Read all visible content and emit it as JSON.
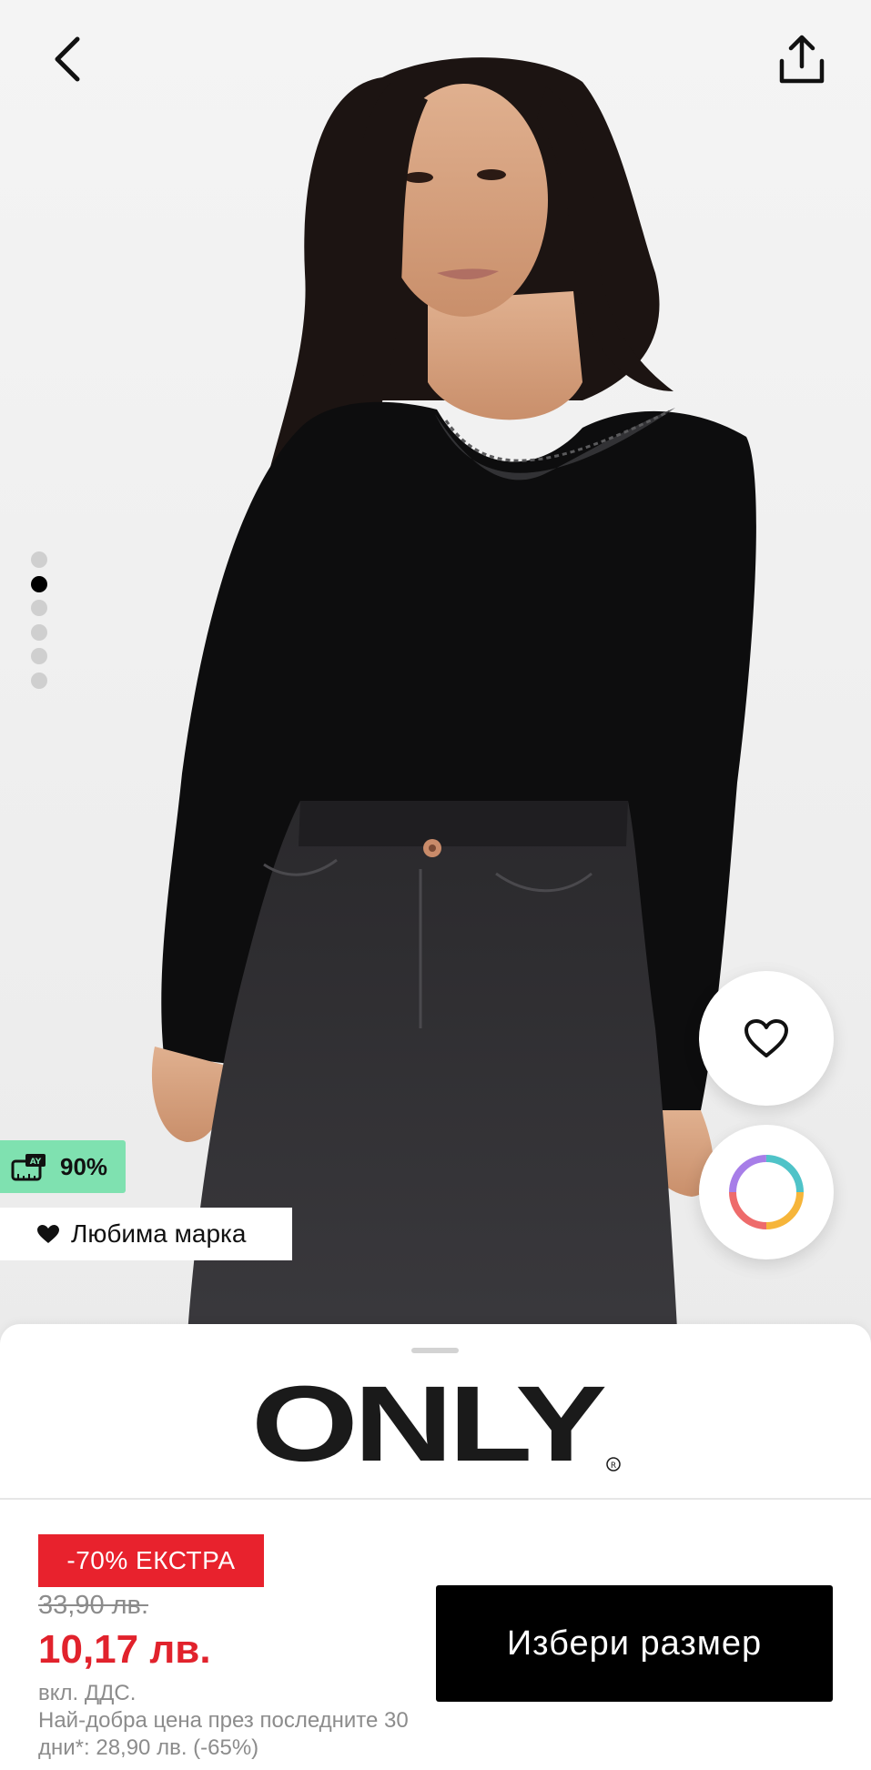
{
  "header": {
    "back_icon": "chevron-left-icon",
    "share_icon": "share-icon"
  },
  "gallery": {
    "image_count": 6,
    "active_index": 1
  },
  "badges": {
    "fit_icon": "measuring-tape-icon",
    "fit_percent": "90%",
    "favorite_brand_icon": "heart-icon",
    "favorite_brand_label": "Любима марка"
  },
  "actions": {
    "wishlist_icon": "heart-outline-icon",
    "colors_icon": "color-wheel-icon"
  },
  "product": {
    "brand": "ONLY",
    "promo_label": "-70% ЕКСТРА",
    "old_price": "33,90 лв.",
    "price": "10,17 лв.",
    "vat_note": "вкл. ДДС.",
    "best_price_note": "Най-добра цена през последните 30 дни*: 28,90 лв. (-65%)",
    "size_button_label": "Избери размер"
  },
  "colors": {
    "promo_red": "#e8222d",
    "price_red": "#e1222c",
    "fit_badge_green": "#7fe1b0",
    "button_black": "#000000",
    "muted_gray": "#8c8c8c"
  }
}
